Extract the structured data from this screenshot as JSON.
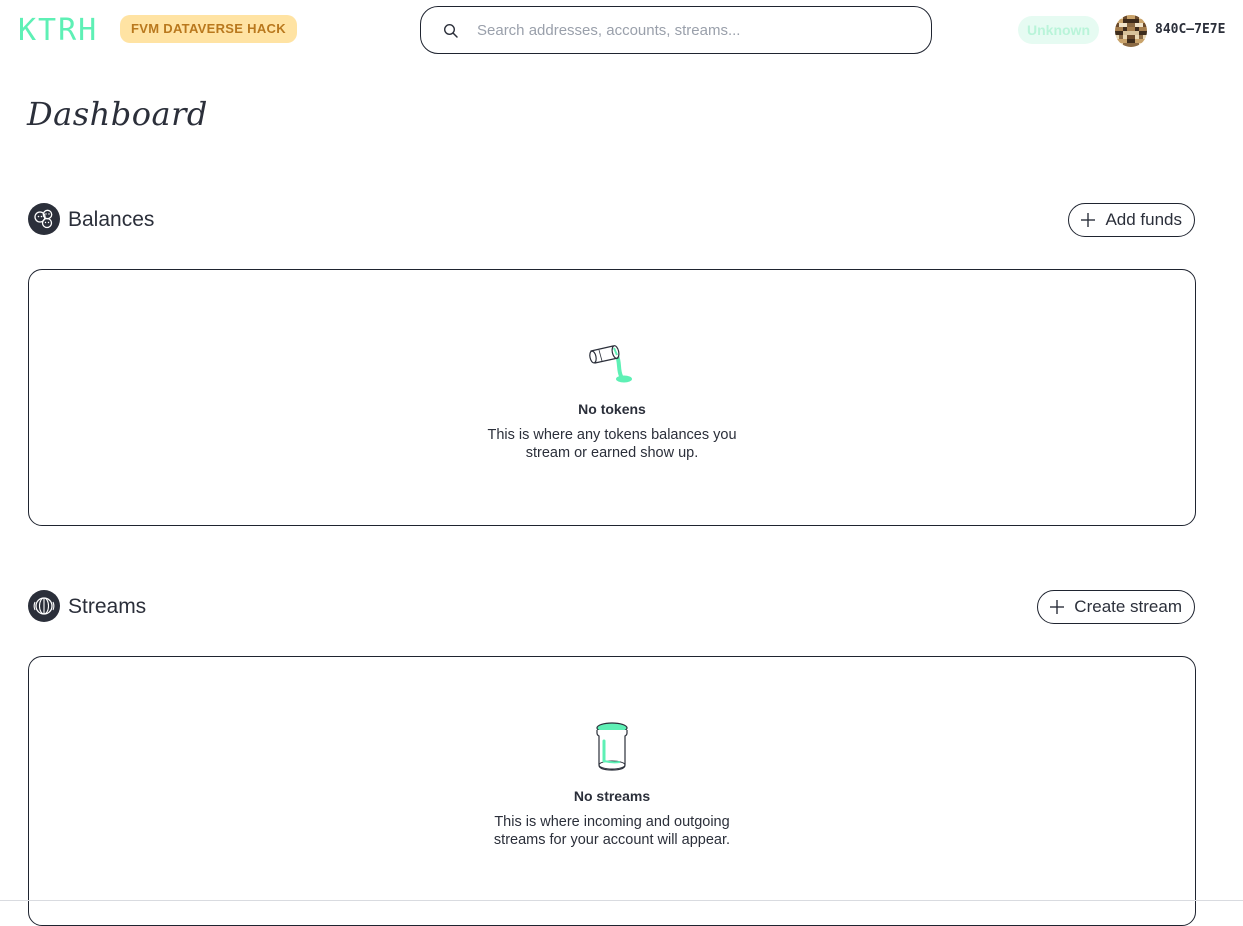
{
  "header": {
    "logo_text": "KTRH",
    "hack_badge": "FVM DATAVERSE HACK",
    "search": {
      "placeholder": "Search addresses, accounts, streams...",
      "value": ""
    },
    "network_status": "Unknown",
    "account_address": "840C—7E7E",
    "icons": {
      "search": "search-icon",
      "avatar": "account-avatar"
    }
  },
  "page": {
    "title": "Dashboard"
  },
  "balances": {
    "title": "Balances",
    "icon": "coins-icon",
    "action_label": "Add funds",
    "empty": {
      "illustration": "tipped-cup-illustration",
      "title": "No tokens",
      "description": "This is where any tokens balances you stream or earned show up."
    }
  },
  "streams": {
    "title": "Streams",
    "icon": "stream-icon",
    "action_label": "Create stream",
    "empty": {
      "illustration": "jar-illustration",
      "title": "No streams",
      "description": "This is where incoming and outgoing streams for your account will appear."
    }
  },
  "colors": {
    "accent": "#5EF0B5",
    "badge_bg": "#FFE3A3",
    "badge_text": "#B9781D",
    "border": "#1F2430",
    "text": "#2B2F3A"
  }
}
